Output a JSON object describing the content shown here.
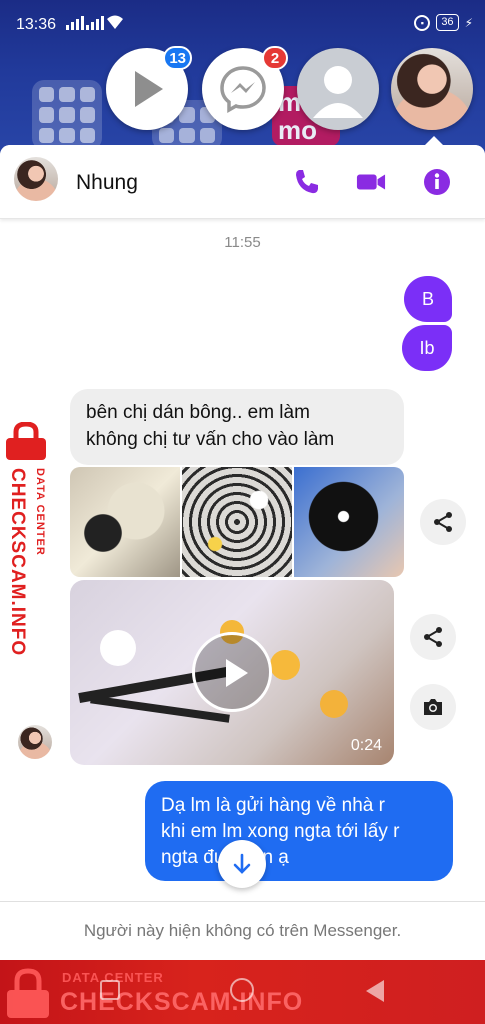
{
  "status_bar": {
    "time": "13:36",
    "battery": "36"
  },
  "chat_heads": {
    "video_badge": "13",
    "messenger_badge": "2"
  },
  "header": {
    "contact_name": "Nhung"
  },
  "conversation": {
    "timestamp": "11:55",
    "my_messages": [
      "B",
      "Ib"
    ],
    "incoming_text_line1": "bên chị dán bông.. em làm",
    "incoming_text_line2": "không chị tư vấn cho vào làm",
    "video_duration": "0:24",
    "reply_line1": "Dạ lm là gửi hàng về nhà r",
    "reply_line2": "khi em lm xong ngta tới lấy r",
    "reply_line3": "ngta đưa tiền ạ"
  },
  "footer": {
    "notice": "Người này hiện không có trên Messenger."
  },
  "watermark": {
    "small": "DATA CENTER",
    "large": "CHECKSCAM.INFO"
  },
  "colors": {
    "accent_purple": "#7b2ff7",
    "message_blue": "#1f6cf2",
    "watermark_red": "#e02020"
  }
}
